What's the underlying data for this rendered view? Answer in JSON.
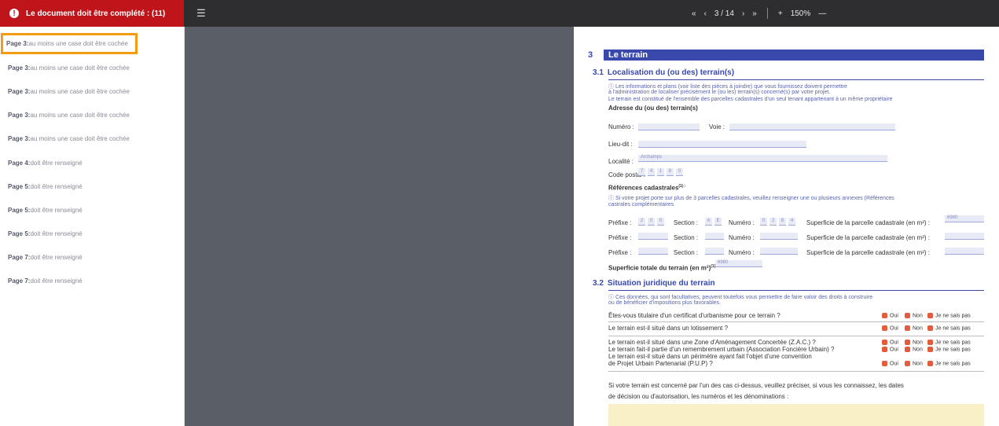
{
  "topbar": {
    "alert": "Le document doit être complété : (11)",
    "pager": {
      "first": "«",
      "prev": "‹",
      "page": "3 / 14",
      "next": "›",
      "last": "»",
      "zoom_in": "+",
      "zoom": "150%",
      "zoom_out": "—"
    }
  },
  "sidebar": {
    "items": [
      {
        "page": "Page 3:",
        "text": "au moins une case doit être cochée",
        "active": true
      },
      {
        "page": "Page 3:",
        "text": "au moins une case doit être cochée"
      },
      {
        "page": "Page 3:",
        "text": "au moins une case doit être cochée"
      },
      {
        "page": "Page 3:",
        "text": "au moins une case doit être cochée"
      },
      {
        "page": "Page 3:",
        "text": "au moins une case doit être cochée"
      },
      {
        "page": "Page 4:",
        "text": "doit être renseigné"
      },
      {
        "page": "Page 5:",
        "text": "doit être renseigné"
      },
      {
        "page": "Page 5:",
        "text": "doit être renseigné"
      },
      {
        "page": "Page 5:",
        "text": "doit être renseigné"
      },
      {
        "page": "Page 7:",
        "text": "doit être renseigné"
      },
      {
        "page": "Page 7:",
        "text": "doit être renseigné"
      }
    ]
  },
  "doc": {
    "section_num": "3",
    "section_title": "Le terrain",
    "s31_num": "3.1",
    "s31_title": "Localisation du (ou des) terrain(s)",
    "s31_info1": "ⓘ Les informations et plans (voir liste des pièces à joindre) que vous fournissez doivent permettre",
    "s31_info2": "à l'administration de localiser précisément le (ou les) terrain(s) concerné(s) par votre projet.",
    "s31_info3": "Le terrain est constitué de l'ensemble des parcelles cadastrales d'un seul tenant appartenant à un même propriétaire",
    "addr_title": "Adresse du (ou des) terrain(s)",
    "numero": "Numéro :",
    "voie": "Voie :",
    "lieudit": "Lieu-dit :",
    "localite": "Localité :",
    "localite_value": "Archamps",
    "cp": "Code postal :",
    "cp_digits": [
      "7",
      "4",
      "1",
      "6",
      "0"
    ],
    "ref_title": "Références cadastrales",
    "ref_sup": "(1) :",
    "ref_info1": "ⓘ Si votre projet porte sur plus de 3 parcelles cadastrales, veuillez renseigner une ou plusieurs annexes (Références",
    "ref_info2": "castrales complémentaires",
    "prefixe": "Préfixe :",
    "section": "Section :",
    "numero2": "Numéro :",
    "superficie": "Superficie de la parcelle cadastrale (en m²) :",
    "row1_prefixe": [
      "2",
      "0",
      "0"
    ],
    "row1_section": [
      "A",
      "E"
    ],
    "row1_numero": [
      "0",
      "2",
      "8",
      "4"
    ],
    "row1_sup": "6980",
    "total_label": "Superficie totale du terrain (en m²)",
    "total_sup": "(1) :",
    "total_value": "6980",
    "s32_num": "3.2",
    "s32_title": "Situation juridique du terrain",
    "s32_info1": "ⓘ Ces données, qui sont facultatives, peuvent toutefois vous permettre de faire valoir des droits à construire",
    "s32_info2": "ou de bénéficier d'impositions plus favorables.",
    "q1": "Êtes-vous titulaire d'un certificat d'urbanisme pour ce terrain ?",
    "q2": "Le terrain est-il situé dans un lotissement ?",
    "q3": "Le terrain est-il situé dans une Zone d'Aménagement Concertée (Z.A.C.) ?",
    "q4": "Le terrain fait-il partie d'un remembrement urbain (Association Foncière Urbain) ?",
    "q5a": "Le terrain est-il situé dans un périmètre ayant fait l'objet d'une convention",
    "q5b": "de Projet Urbain Partenarial (P.U.P) ?",
    "oui": "Oui",
    "non": "Non",
    "nsp": "Je ne sais pas",
    "foot1": "Si votre terrain est concerné par l'un des cas ci-dessus, veuillez préciser, si vous les connaissez, les dates",
    "foot2": "de décision ou d'autorisation, les numéros et les dénominations :"
  }
}
